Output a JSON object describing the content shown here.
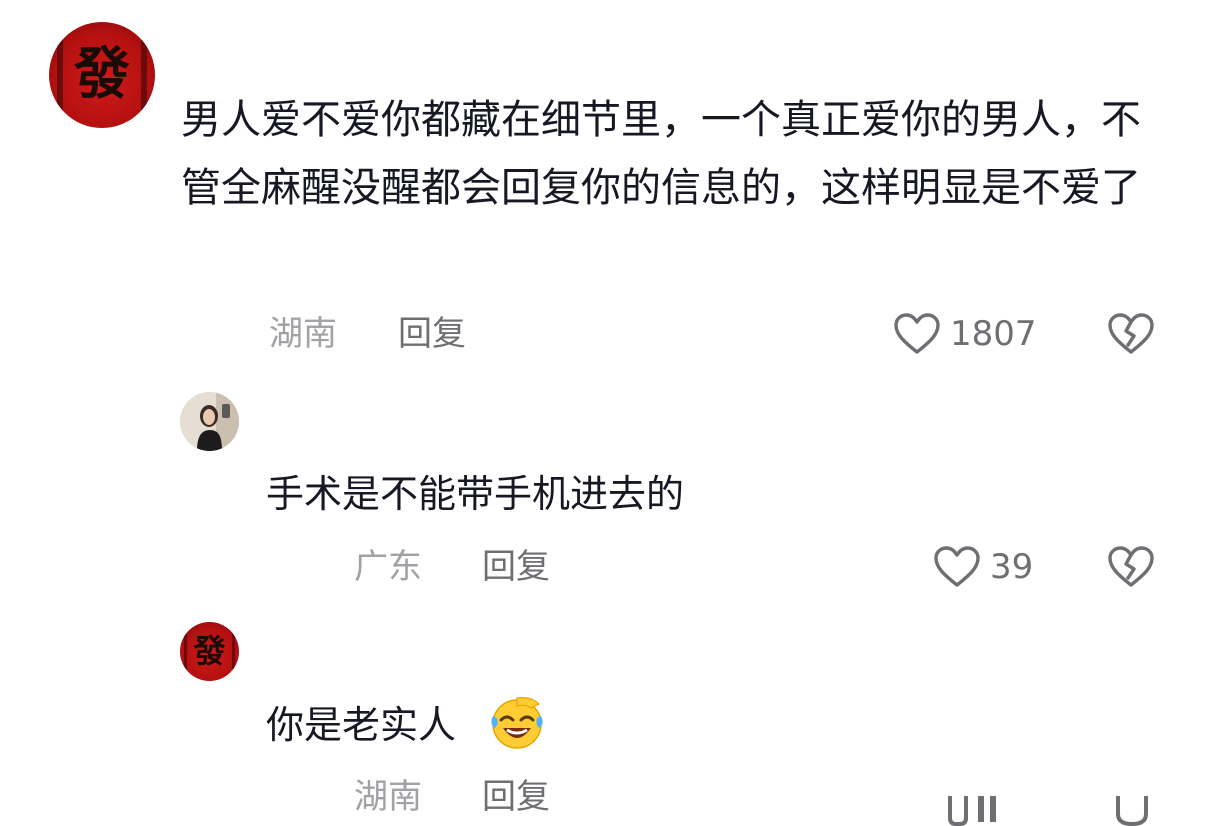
{
  "comments": [
    {
      "avatar": "fa-character-red-avatar",
      "text": "男人爱不爱你都藏在细节里，一个真正爱你的男人，不管全麻醒没醒都会回复你的信息的，这样明显是不爱了",
      "location": "湖南",
      "reply_label": "回复",
      "likes": "1807"
    },
    {
      "avatar": "girl-photo-avatar",
      "text": "手术是不能带手机进去的",
      "location": "广东",
      "reply_label": "回复",
      "likes": "39"
    },
    {
      "avatar": "fa-character-red-avatar",
      "text": "你是老实人",
      "emoji": "laughing-crying-emoji",
      "location": "湖南",
      "reply_label": "回复",
      "likes": ""
    }
  ],
  "avatar_glyph": "發",
  "icons": {
    "like": "heart-outline-icon",
    "dislike": "broken-heart-icon"
  },
  "colors": {
    "text": "#161823",
    "meta": "#a1a1a6",
    "reply": "#6e6e73",
    "avatar_red": "#c0141a"
  }
}
